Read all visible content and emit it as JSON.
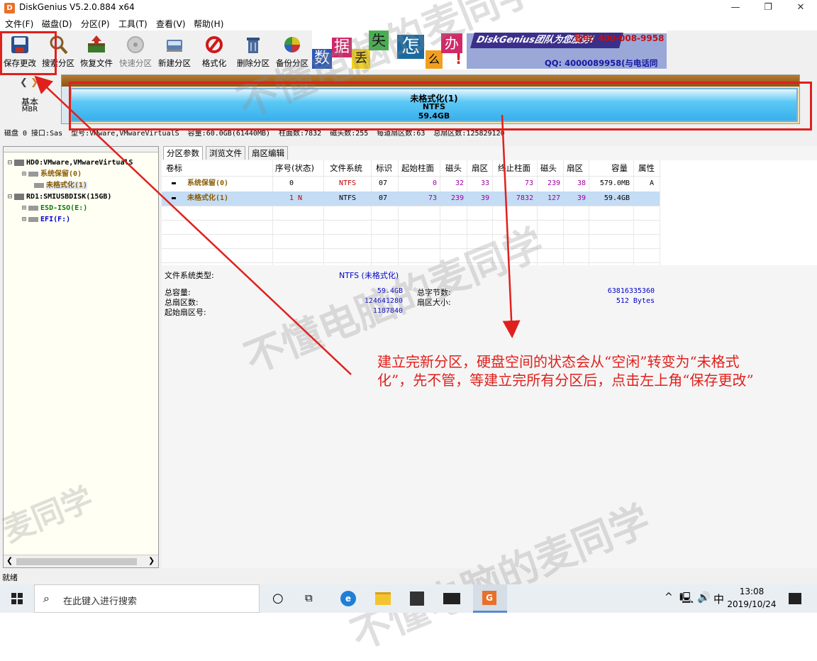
{
  "app": {
    "title": "DiskGenius V5.2.0.884 x64",
    "icon_letter": "D",
    "window_controls": {
      "minimize": "—",
      "maximize": "❐",
      "close": "✕"
    }
  },
  "menu": [
    "文件(F)",
    "磁盘(D)",
    "分区(P)",
    "工具(T)",
    "查看(V)",
    "帮助(H)"
  ],
  "toolbar": [
    {
      "label": "保存更改",
      "icon": "save-disk-icon",
      "enabled": true
    },
    {
      "label": "搜索分区",
      "icon": "magnifier-icon",
      "enabled": true
    },
    {
      "label": "恢复文件",
      "icon": "recover-box-icon",
      "enabled": true
    },
    {
      "label": "快速分区",
      "icon": "quick-partition-icon",
      "enabled": false
    },
    {
      "label": "新建分区",
      "icon": "new-partition-icon",
      "enabled": true
    },
    {
      "label": "格式化",
      "icon": "format-icon",
      "enabled": true
    },
    {
      "label": "删除分区",
      "icon": "trash-icon",
      "enabled": true
    },
    {
      "label": "备份分区",
      "icon": "backup-pie-icon",
      "enabled": true
    }
  ],
  "banner": {
    "chars": [
      "数",
      "据",
      "丢",
      "失",
      "怎",
      "么",
      "办",
      "!"
    ],
    "brand": "DiskGenius团队为您服务!",
    "phone": "致电: 400-008-9958",
    "qq": "QQ: 4000089958(与电话同号)"
  },
  "diskmap": {
    "basic": "基本",
    "mbr": "MBR",
    "partition_name": "未格式化(1)",
    "partition_fs": "NTFS",
    "partition_size": "59.4GB"
  },
  "disk_info_line": "磁盘 0 接口:Sas  型号:VMware,VMwareVirtualS  容量:60.0GB(61440MB)  柱面数:7832  磁头数:255  每道扇区数:63  总扇区数:125829120",
  "tree": [
    {
      "label": "HD0:VMware,VMwareVirtualS",
      "level": 0,
      "color": "#000000"
    },
    {
      "label": "系统保留(0)",
      "level": 1,
      "color": "#8b5a00"
    },
    {
      "label": "未格式化(1)",
      "level": 1,
      "color": "#8b5a00",
      "selected": true
    },
    {
      "label": "RD1:SMIUSBDISK(15GB)",
      "level": 0,
      "color": "#000000"
    },
    {
      "label": "ESD-ISO(E:)",
      "level": 1,
      "color": "#008000"
    },
    {
      "label": "EFI(F:)",
      "level": 1,
      "color": "#0000cc"
    }
  ],
  "tabs": [
    "分区参数",
    "浏览文件",
    "扇区编辑"
  ],
  "table": {
    "headers": [
      "卷标",
      "序号(状态)",
      "文件系统",
      "标识",
      "起始柱面",
      "磁头",
      "扇区",
      "终止柱面",
      "磁头",
      "扇区",
      "容量",
      "属性"
    ],
    "rows": [
      [
        "系统保留(0)",
        "0",
        "NTFS",
        "07",
        "0",
        "32",
        "33",
        "73",
        "239",
        "38",
        "579.0MB",
        "A"
      ],
      [
        "未格式化(1)",
        "1 N",
        "NTFS",
        "07",
        "73",
        "239",
        "39",
        "7832",
        "127",
        "39",
        "59.4GB",
        ""
      ]
    ]
  },
  "details": {
    "fs_type_label": "文件系统类型:",
    "fs_type_value": "NTFS (未格式化)",
    "total_capacity_label": "总容量:",
    "total_capacity_value": "59.4GB",
    "total_bytes_label": "总字节数:",
    "total_bytes_value": "63816335360",
    "total_sectors_label": "总扇区数:",
    "total_sectors_value": "124641280",
    "sector_size_label": "扇区大小:",
    "sector_size_value": "512 Bytes",
    "start_sector_label": "起始扇区号:",
    "start_sector_value": "1187840"
  },
  "status": "就绪",
  "annotation": "建立完新分区，硬盘空间的状态会从“空闲”转变为“未格式化”，先不管，等建立完所有分区后，点击左上角“保存更改”",
  "watermarks": [
    "不懂电脑的麦同学",
    "不懂电脑的麦同学",
    "不懂电脑的麦同学",
    "麦同学"
  ],
  "taskbar": {
    "search_placeholder": "在此键入进行搜索",
    "time": "13:08",
    "date": "2019/10/24",
    "ime": "中",
    "tray": [
      "^",
      "🖳",
      "🔊"
    ]
  },
  "colors": {
    "accent_red": "#e0201c",
    "partition_blue": "#5bc8f5",
    "disk_header_brown": "#a0621c"
  }
}
